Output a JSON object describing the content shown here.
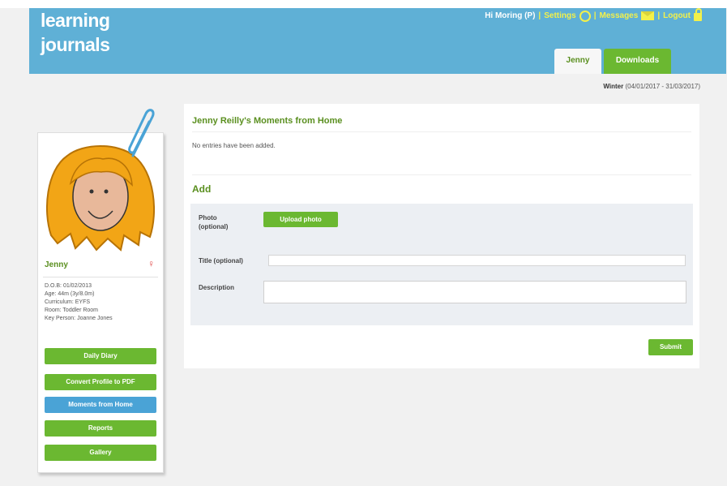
{
  "header": {
    "logo_line1": "learning",
    "logo_line2": "journals",
    "greeting": "Hi Moring (P)",
    "nav": {
      "settings": "Settings",
      "messages": "Messages",
      "logout": "Logout"
    },
    "separator": "|",
    "tabs": [
      {
        "label": "Jenny",
        "active": true
      },
      {
        "label": "Downloads",
        "active": false
      }
    ],
    "term_label": "Winter",
    "term_range": "(04/01/2017 - 31/03/2017)"
  },
  "profile": {
    "name": "Jenny",
    "gender_icon": "female-symbol-icon",
    "gender_glyph": "♀",
    "info": [
      "D.O.B: 01/02/2013",
      "Age: 44m (3y/8.0m)",
      "Curriculum: EYFS",
      "Room: Toddler Room",
      "Key Person: Joanne Jones"
    ],
    "buttons": [
      {
        "label": "Daily Diary",
        "color": "green"
      },
      {
        "label": "Convert Profile to PDF",
        "color": "green"
      },
      {
        "label": "Moments from Home",
        "color": "blue"
      },
      {
        "label": "Reports",
        "color": "green"
      },
      {
        "label": "Gallery",
        "color": "green"
      }
    ]
  },
  "main": {
    "title": "Jenny Reilly's Moments from Home",
    "empty_message": "No entries have been added.",
    "add_heading": "Add",
    "form": {
      "photo_label_1": "Photo",
      "photo_label_2": "(optional)",
      "upload_button": "Upload photo",
      "title_label": "Title (optional)",
      "title_value": "",
      "description_label": "Description",
      "description_value": ""
    },
    "submit_button": "Submit"
  },
  "colors": {
    "header_blue": "#5fb0d6",
    "accent_green": "#6bb831",
    "title_green": "#5a8f1f",
    "nav_yellow": "#f3f04a",
    "button_blue": "#4aa3d6"
  }
}
